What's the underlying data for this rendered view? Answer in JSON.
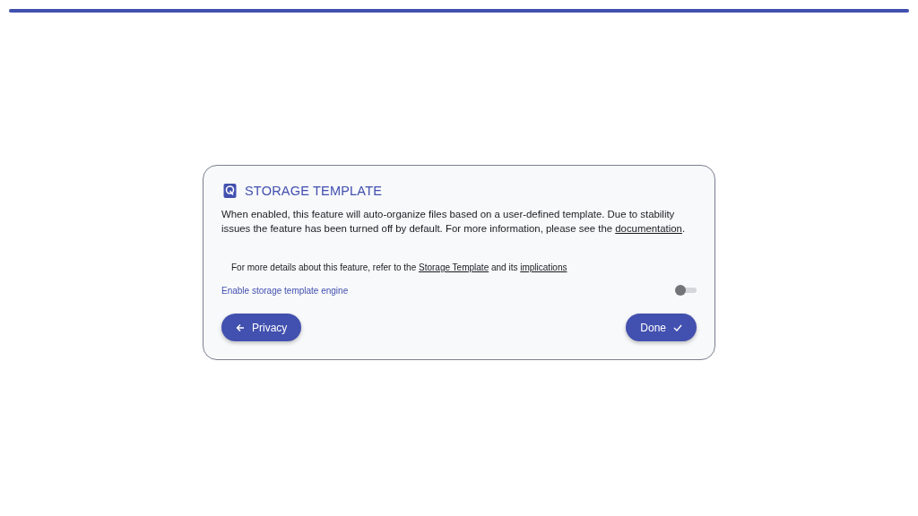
{
  "progress": {
    "level": 1
  },
  "card": {
    "title": "STORAGE TEMPLATE",
    "description": [
      {
        "kind": "text",
        "text": "When enabled, this feature will auto-organize files based on a user-defined template. Due to stability issues the feature has been turned off by default. For more information, please see the "
      },
      {
        "kind": "link",
        "text": "documentation"
      },
      {
        "kind": "text",
        "text": "."
      }
    ],
    "details": [
      {
        "kind": "text",
        "text": "For more details about this feature, refer to the "
      },
      {
        "kind": "link",
        "text": "Storage Template"
      },
      {
        "kind": "text",
        "text": " and its "
      },
      {
        "kind": "link",
        "text": "implications"
      }
    ],
    "setting": {
      "label": "Enable storage template engine",
      "on": false
    },
    "buttons": [
      {
        "label": "Privacy",
        "kind": "back"
      },
      {
        "label": "Done",
        "kind": "done"
      }
    ]
  }
}
